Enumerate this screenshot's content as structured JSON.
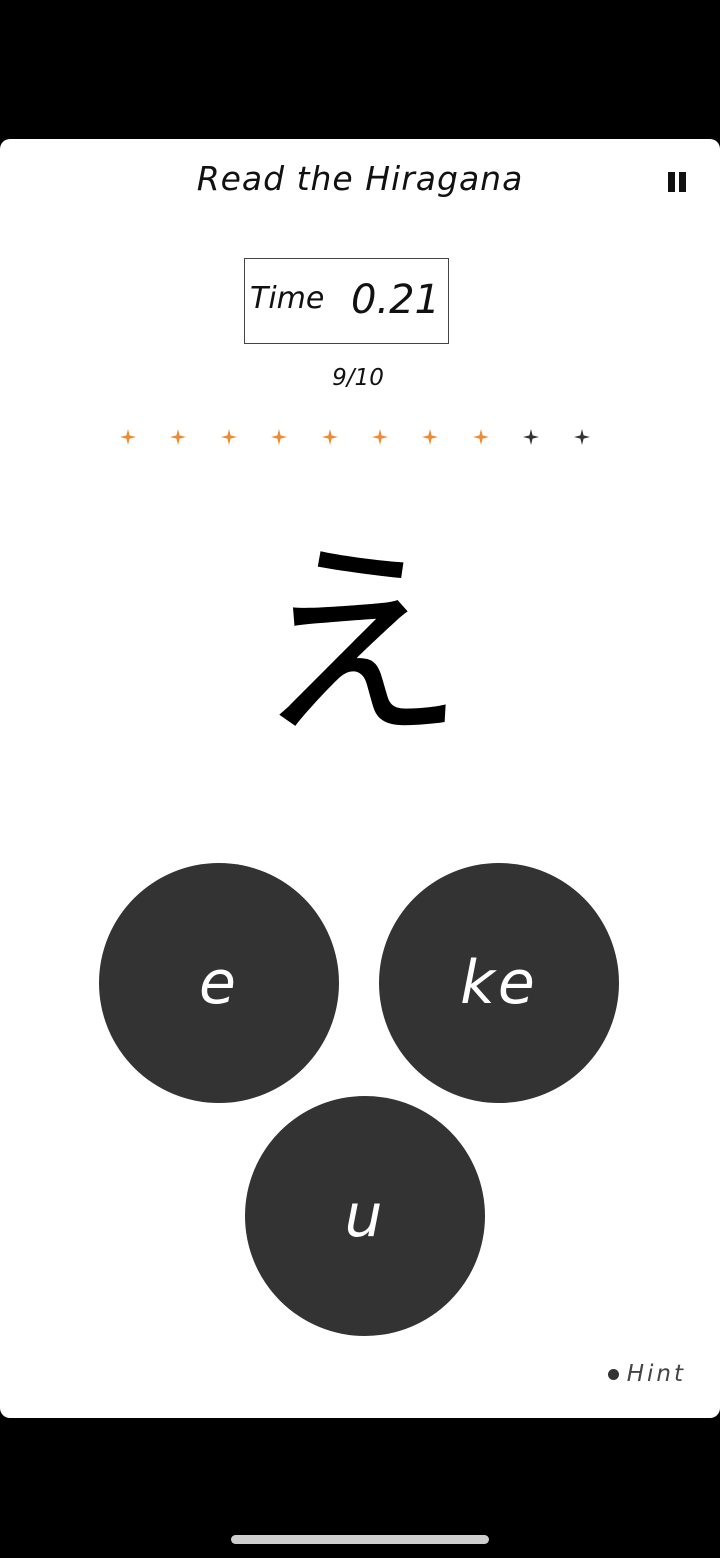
{
  "header": {
    "title": "Read the Hiragana",
    "pause_icon": "pause-icon"
  },
  "timer": {
    "label": "Time",
    "value": "0.21"
  },
  "progress": {
    "text": "9/10",
    "total": 10,
    "completed": 8
  },
  "colors": {
    "completed_star": "#f08a32",
    "pending_star": "#333333",
    "button_bg": "#333333",
    "card_bg": "#ffffff"
  },
  "question": {
    "kana": "え"
  },
  "answers": [
    {
      "label": "e"
    },
    {
      "label": "ke"
    },
    {
      "label": "u"
    }
  ],
  "hint": {
    "label": "Hint"
  }
}
